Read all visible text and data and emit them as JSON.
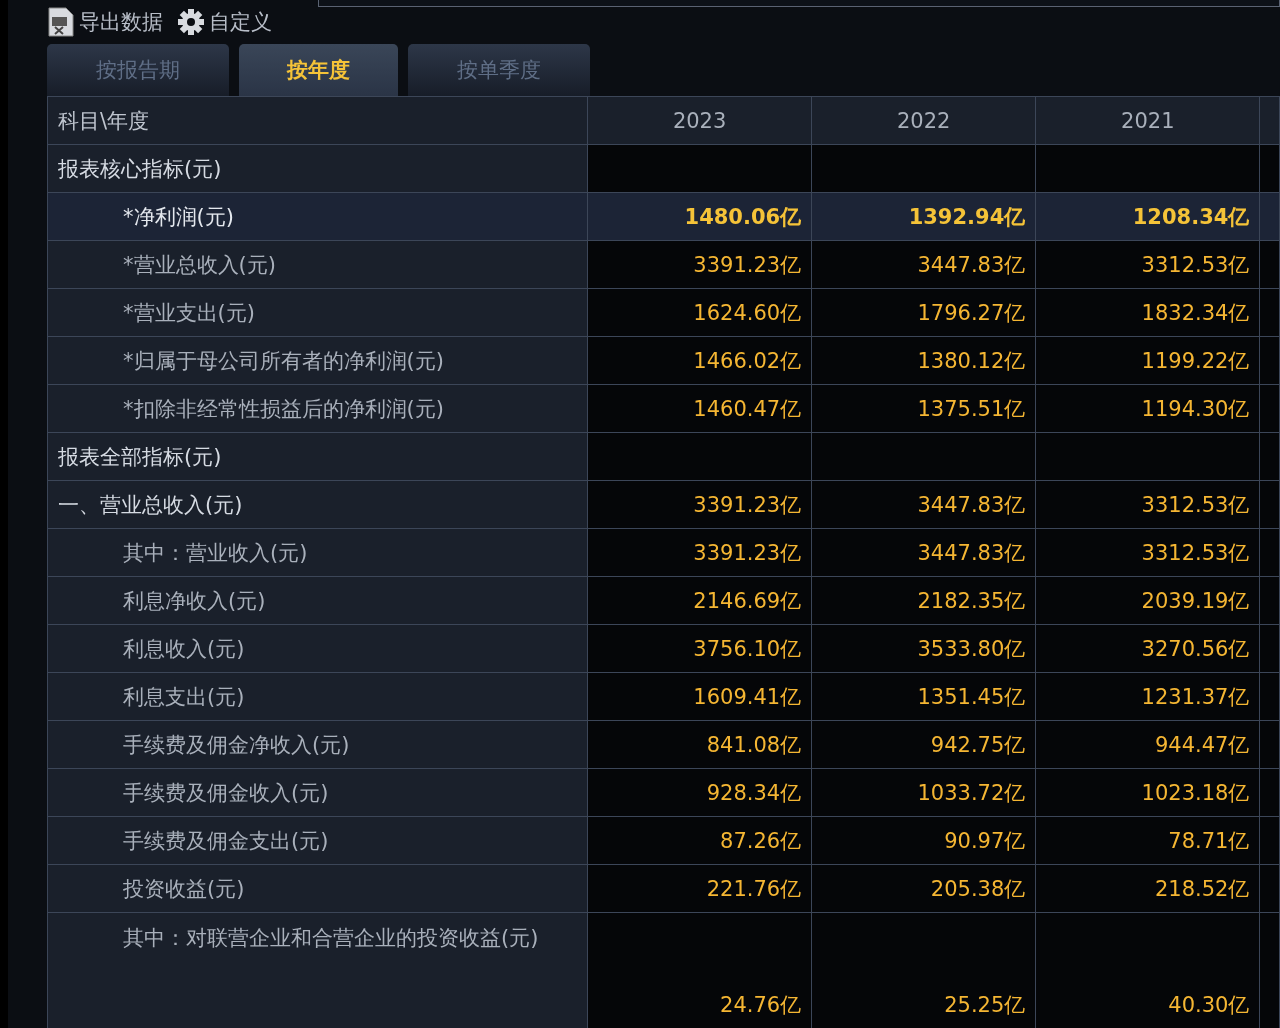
{
  "toolbar": [
    {
      "kind": "export",
      "label": "导出数据"
    },
    {
      "kind": "settings",
      "label": "自定义"
    }
  ],
  "tabs": [
    {
      "label": "按报告期",
      "selected": false
    },
    {
      "label": "按年度",
      "selected": true
    },
    {
      "label": "按单季度",
      "selected": false
    }
  ],
  "table": {
    "columns": [
      "科目\\年度",
      "2023",
      "2022",
      "2021"
    ],
    "rows": [
      {
        "kind": "section",
        "label": "报表核心指标(元)",
        "values": []
      },
      {
        "kind": "key",
        "label": "*净利润(元)",
        "values": [
          "1480.06亿",
          "1392.94亿",
          "1208.34亿"
        ]
      },
      {
        "kind": "sub",
        "label": "*营业总收入(元)",
        "values": [
          "3391.23亿",
          "3447.83亿",
          "3312.53亿"
        ]
      },
      {
        "kind": "sub",
        "label": "*营业支出(元)",
        "values": [
          "1624.60亿",
          "1796.27亿",
          "1832.34亿"
        ]
      },
      {
        "kind": "sub",
        "label": "*归属于母公司所有者的净利润(元)",
        "values": [
          "1466.02亿",
          "1380.12亿",
          "1199.22亿"
        ]
      },
      {
        "kind": "sub",
        "label": "*扣除非经常性损益后的净利润(元)",
        "values": [
          "1460.47亿",
          "1375.51亿",
          "1194.30亿"
        ]
      },
      {
        "kind": "section",
        "label": "报表全部指标(元)",
        "values": []
      },
      {
        "kind": "main",
        "label": "一、营业总收入(元)",
        "values": [
          "3391.23亿",
          "3447.83亿",
          "3312.53亿"
        ]
      },
      {
        "kind": "sub",
        "label": "其中：营业收入(元)",
        "values": [
          "3391.23亿",
          "3447.83亿",
          "3312.53亿"
        ]
      },
      {
        "kind": "sub",
        "label": "利息净收入(元)",
        "values": [
          "2146.69亿",
          "2182.35亿",
          "2039.19亿"
        ]
      },
      {
        "kind": "sub",
        "label": "利息收入(元)",
        "values": [
          "3756.10亿",
          "3533.80亿",
          "3270.56亿"
        ]
      },
      {
        "kind": "sub",
        "label": "利息支出(元)",
        "values": [
          "1609.41亿",
          "1351.45亿",
          "1231.37亿"
        ]
      },
      {
        "kind": "sub",
        "label": "手续费及佣金净收入(元)",
        "values": [
          "841.08亿",
          "942.75亿",
          "944.47亿"
        ]
      },
      {
        "kind": "sub",
        "label": "手续费及佣金收入(元)",
        "values": [
          "928.34亿",
          "1033.72亿",
          "1023.18亿"
        ]
      },
      {
        "kind": "sub",
        "label": "手续费及佣金支出(元)",
        "values": [
          "87.26亿",
          "90.97亿",
          "78.71亿"
        ]
      },
      {
        "kind": "sub",
        "label": "投资收益(元)",
        "values": [
          "221.76亿",
          "205.38亿",
          "218.52亿"
        ]
      },
      {
        "kind": "sub",
        "label": "其中：对联营企业和合营企业的投资收益(元)",
        "values": [
          "24.76亿",
          "25.25亿",
          "40.30亿"
        ]
      }
    ]
  }
}
